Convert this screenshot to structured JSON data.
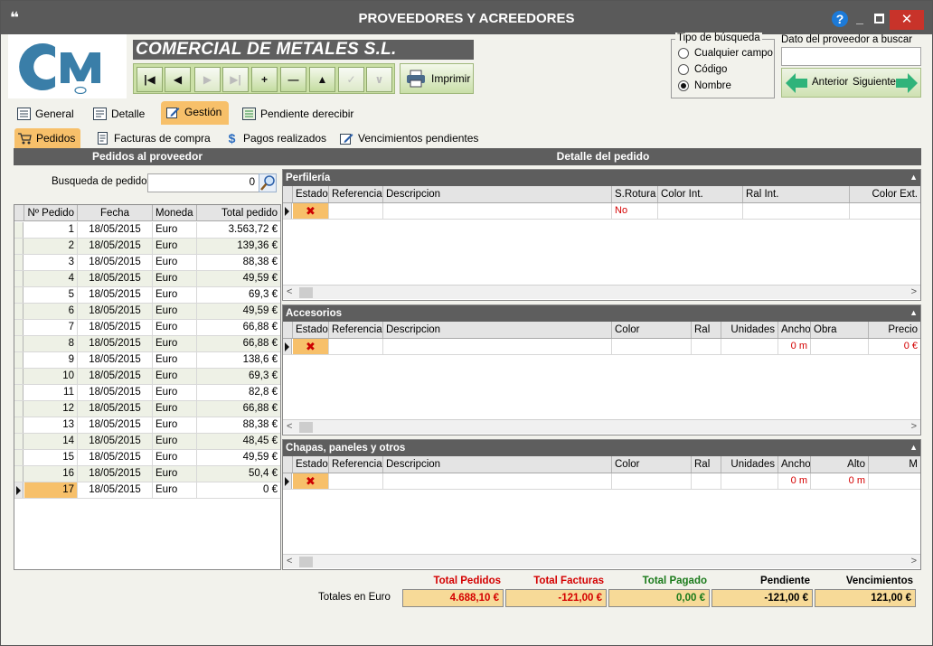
{
  "window": {
    "title": "PROVEEDORES Y ACREEDORES"
  },
  "header": {
    "company": "COMERCIAL DE METALES S.L.",
    "print_label": "Imprimir"
  },
  "search_type": {
    "legend": "Tipo de búsqueda",
    "options": [
      "Cualquier campo",
      "Código",
      "Nombre"
    ],
    "selected": "Nombre"
  },
  "provider_search": {
    "label": "Dato del proveedor a buscar",
    "value": "",
    "prev": "Anterior",
    "next": "Siguiente"
  },
  "tabs": [
    "General",
    "Detalle",
    "Gestión",
    "Pendiente derecibir"
  ],
  "active_tab": "Gestión",
  "subtabs": [
    "Pedidos",
    "Facturas de compra",
    "Pagos realizados",
    "Vencimientos pendientes"
  ],
  "active_subtab": "Pedidos",
  "sections": {
    "left": "Pedidos al proveedor",
    "right": "Detalle del pedido"
  },
  "orders": {
    "search_label": "Busqueda de pedidos",
    "search_value": "0",
    "columns": [
      "Nº Pedido",
      "Fecha",
      "Moneda",
      "Total pedido"
    ],
    "rows": [
      [
        "1",
        "18/05/2015",
        "Euro",
        "3.563,72 €"
      ],
      [
        "2",
        "18/05/2015",
        "Euro",
        "139,36 €"
      ],
      [
        "3",
        "18/05/2015",
        "Euro",
        "88,38 €"
      ],
      [
        "4",
        "18/05/2015",
        "Euro",
        "49,59 €"
      ],
      [
        "5",
        "18/05/2015",
        "Euro",
        "69,3 €"
      ],
      [
        "6",
        "18/05/2015",
        "Euro",
        "49,59 €"
      ],
      [
        "7",
        "18/05/2015",
        "Euro",
        "66,88 €"
      ],
      [
        "8",
        "18/05/2015",
        "Euro",
        "66,88 €"
      ],
      [
        "9",
        "18/05/2015",
        "Euro",
        "138,6 €"
      ],
      [
        "10",
        "18/05/2015",
        "Euro",
        "69,3 €"
      ],
      [
        "11",
        "18/05/2015",
        "Euro",
        "82,8 €"
      ],
      [
        "12",
        "18/05/2015",
        "Euro",
        "66,88 €"
      ],
      [
        "13",
        "18/05/2015",
        "Euro",
        "88,38 €"
      ],
      [
        "14",
        "18/05/2015",
        "Euro",
        "48,45 €"
      ],
      [
        "15",
        "18/05/2015",
        "Euro",
        "49,59 €"
      ],
      [
        "16",
        "18/05/2015",
        "Euro",
        "50,4 €"
      ],
      [
        "17",
        "18/05/2015",
        "Euro",
        "0 €"
      ]
    ],
    "selected_row": "17"
  },
  "perfileria": {
    "title": "Perfilería",
    "columns": [
      "Estado",
      "Referencia",
      "Descripcion",
      "S.Rotura",
      "Color Int.",
      "Ral Int.",
      "Color Ext."
    ],
    "row": {
      "srotura": "No"
    }
  },
  "accesorios": {
    "title": "Accesorios",
    "columns": [
      "Estado",
      "Referencia",
      "Descripcion",
      "Color",
      "Ral",
      "Unidades",
      "Ancho",
      "Obra",
      "Precio"
    ],
    "row": {
      "ancho": "0 m",
      "precio": "0 €"
    }
  },
  "chapas": {
    "title": "Chapas, paneles y otros",
    "columns": [
      "Estado",
      "Referencia",
      "Descripcion",
      "Color",
      "Ral",
      "Unidades",
      "Ancho",
      "Alto",
      "M"
    ],
    "row": {
      "ancho": "0 m",
      "alto": "0 m"
    }
  },
  "totals": {
    "label": "Totales en Euro",
    "headers": [
      "Total Pedidos",
      "Total Facturas",
      "Total Pagado",
      "Pendiente",
      "Vencimientos"
    ],
    "values": [
      "4.688,10 €",
      "-121,00 €",
      "0,00 €",
      "-121,00 €",
      "121,00 €"
    ],
    "header_colors": [
      "#d40000",
      "#d40000",
      "#1a7a1a",
      "#000000",
      "#000000"
    ],
    "value_colors": [
      "#d40000",
      "#d40000",
      "#1a7a1a",
      "#000000",
      "#000000"
    ]
  },
  "colors": {
    "accent": "#f7c06a",
    "titlebar": "#5a5a5a",
    "delete": "#cc0000"
  }
}
